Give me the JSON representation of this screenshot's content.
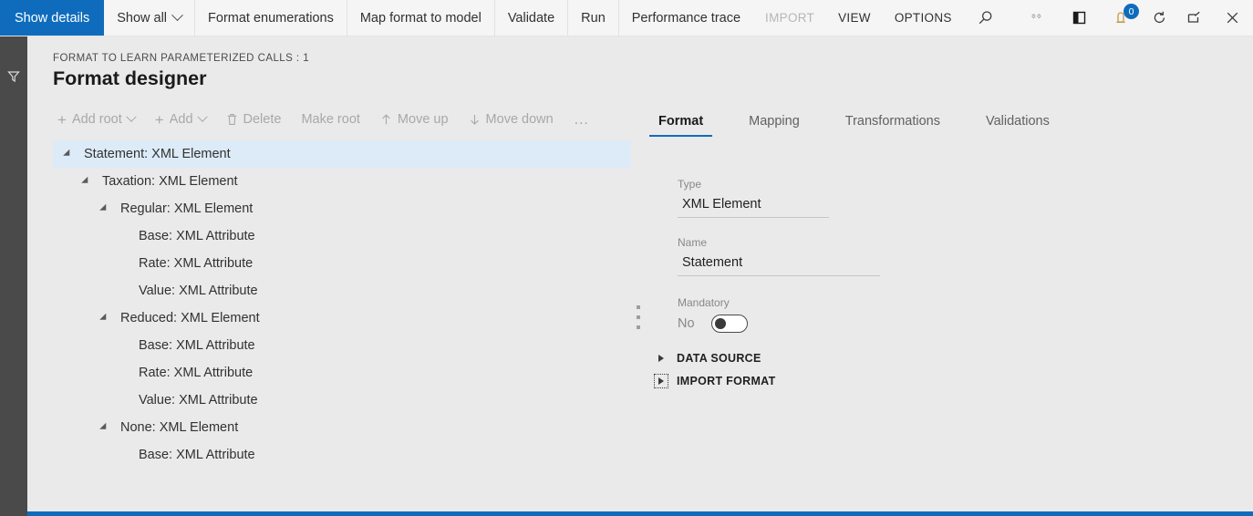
{
  "topbar": {
    "show_details_label": "Show details",
    "items": [
      {
        "label": "Show all",
        "chevron": true,
        "disabled": false,
        "caps": false
      },
      {
        "label": "Format enumerations",
        "chevron": false,
        "disabled": false,
        "caps": false
      },
      {
        "label": "Map format to model",
        "chevron": false,
        "disabled": false,
        "caps": false
      },
      {
        "label": "Validate",
        "chevron": false,
        "disabled": false,
        "caps": false
      },
      {
        "label": "Run",
        "chevron": false,
        "disabled": false,
        "caps": false
      },
      {
        "label": "Performance trace",
        "chevron": false,
        "disabled": false,
        "caps": false
      },
      {
        "label": "IMPORT",
        "chevron": false,
        "disabled": true,
        "caps": true
      },
      {
        "label": "VIEW",
        "chevron": false,
        "disabled": false,
        "caps": true
      },
      {
        "label": "OPTIONS",
        "chevron": false,
        "disabled": false,
        "caps": true
      }
    ],
    "search_icon": "search-icon",
    "right_icons": [
      {
        "name": "settings-gears-icon",
        "badge": null
      },
      {
        "name": "book-panel-icon",
        "badge": null
      },
      {
        "name": "notifications-icon",
        "badge": "0"
      },
      {
        "name": "refresh-icon",
        "badge": null
      },
      {
        "name": "open-in-new-window-icon",
        "badge": null
      },
      {
        "name": "close-icon",
        "badge": null
      }
    ],
    "accent_color": "#0F6CBD"
  },
  "rail": {
    "filter_icon": "filter-funnel-icon"
  },
  "header": {
    "breadcrumb": "FORMAT TO LEARN PARAMETERIZED CALLS : 1",
    "title": "Format designer"
  },
  "actionbar": {
    "items": [
      {
        "label": "Add root",
        "icon": "plus-icon",
        "chevron": true
      },
      {
        "label": "Add",
        "icon": "plus-icon",
        "chevron": true
      },
      {
        "label": "Delete",
        "icon": "trash-icon",
        "chevron": false
      },
      {
        "label": "Make root",
        "icon": null,
        "chevron": false
      },
      {
        "label": "Move up",
        "icon": "arrow-up-icon",
        "chevron": false
      },
      {
        "label": "Move down",
        "icon": "arrow-down-icon",
        "chevron": false
      },
      {
        "label": "…",
        "icon": "overflow-dots-icon",
        "chevron": false
      }
    ]
  },
  "tree": {
    "rows": [
      {
        "label": "Statement: XML Element",
        "depth": 0,
        "expandable": true,
        "selected": true
      },
      {
        "label": "Taxation: XML Element",
        "depth": 1,
        "expandable": true,
        "selected": false
      },
      {
        "label": "Regular: XML Element",
        "depth": 2,
        "expandable": true,
        "selected": false
      },
      {
        "label": "Base: XML Attribute",
        "depth": 3,
        "expandable": false,
        "selected": false
      },
      {
        "label": "Rate: XML Attribute",
        "depth": 3,
        "expandable": false,
        "selected": false
      },
      {
        "label": "Value: XML Attribute",
        "depth": 3,
        "expandable": false,
        "selected": false
      },
      {
        "label": "Reduced: XML Element",
        "depth": 2,
        "expandable": true,
        "selected": false
      },
      {
        "label": "Base: XML Attribute",
        "depth": 3,
        "expandable": false,
        "selected": false
      },
      {
        "label": "Rate: XML Attribute",
        "depth": 3,
        "expandable": false,
        "selected": false
      },
      {
        "label": "Value: XML Attribute",
        "depth": 3,
        "expandable": false,
        "selected": false
      },
      {
        "label": "None: XML Element",
        "depth": 2,
        "expandable": true,
        "selected": false
      },
      {
        "label": "Base: XML Attribute",
        "depth": 3,
        "expandable": false,
        "selected": false
      }
    ]
  },
  "detail": {
    "tabs": [
      {
        "label": "Format",
        "active": true
      },
      {
        "label": "Mapping",
        "active": false
      },
      {
        "label": "Transformations",
        "active": false
      },
      {
        "label": "Validations",
        "active": false
      }
    ],
    "type_label": "Type",
    "type_value": "XML Element",
    "name_label": "Name",
    "name_value": "Statement",
    "mandatory_label": "Mandatory",
    "mandatory_state": "No",
    "sections": [
      {
        "label": "DATA SOURCE",
        "expanded": false,
        "focused": false
      },
      {
        "label": "IMPORT FORMAT",
        "expanded": false,
        "focused": true
      }
    ]
  }
}
